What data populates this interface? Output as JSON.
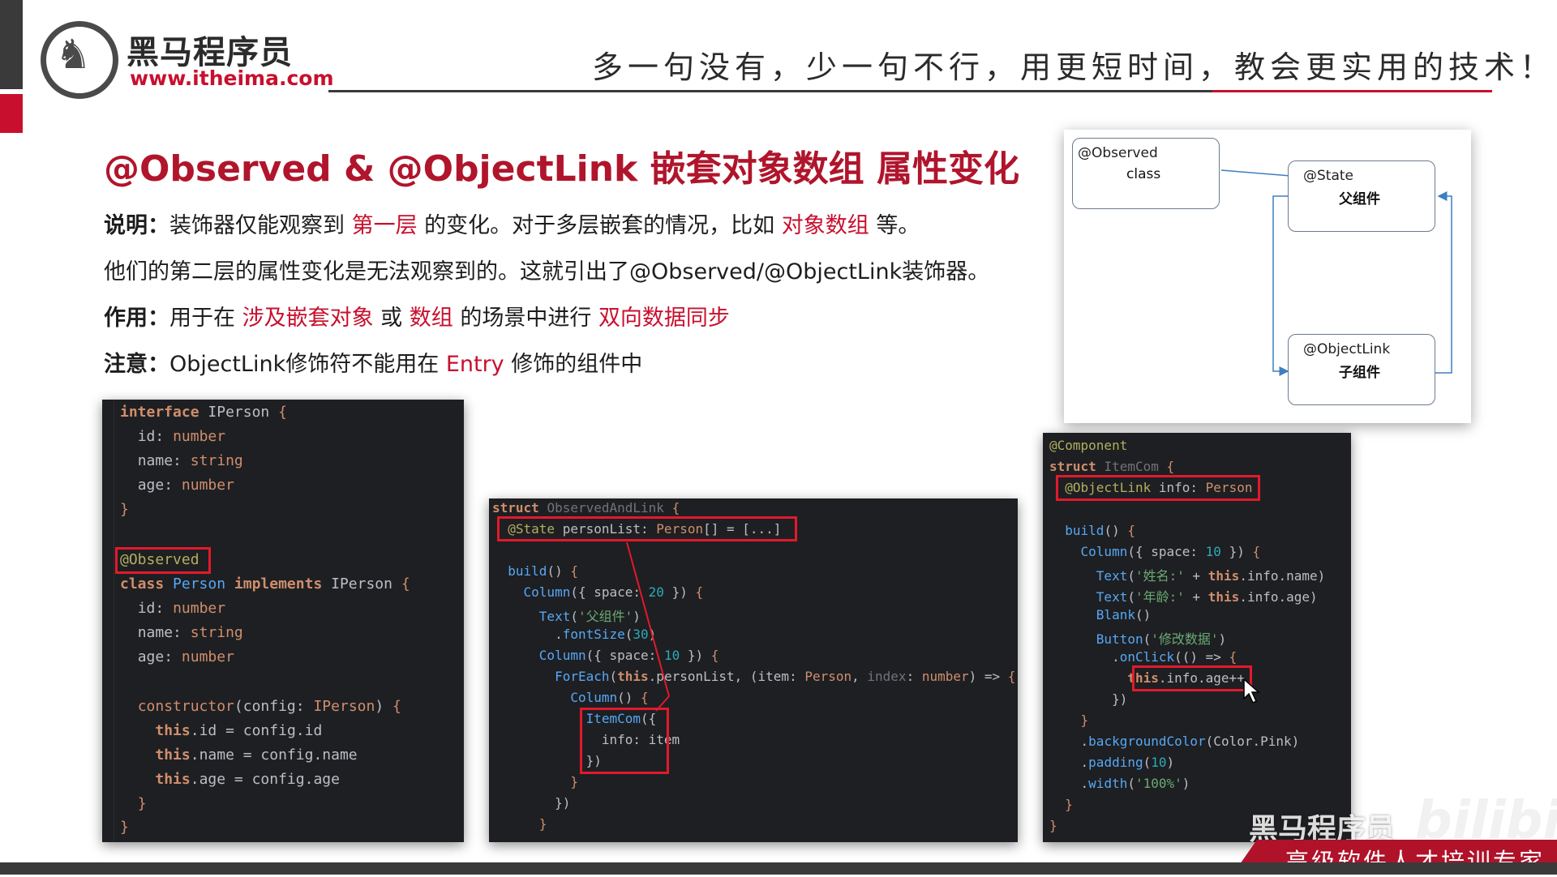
{
  "header": {
    "brand_cn": "黑马程序员",
    "brand_url": "www.itheima.com",
    "slogan": "多一句没有，少一句不行，用更短时间，教会更实用的技术！"
  },
  "slide": {
    "title": "@Observed & @ObjectLink 嵌套对象数组 属性变化",
    "desc1": {
      "label": "说明：",
      "t1": "装饰器仅能观察到 ",
      "h1": "第一层",
      "t2": " 的变化。对于多层嵌套的情况，比如 ",
      "h2": "对象数组",
      "t3": " 等。"
    },
    "desc2": "他们的第二层的属性变化是无法观察到的。这就引出了@Observed/@ObjectLink装饰器。",
    "desc3": {
      "label": "作用：",
      "t1": "用于在 ",
      "h1": "涉及嵌套对象",
      "t2": " 或 ",
      "h2": "数组",
      "t3": " 的场景中进行 ",
      "h3": "双向数据同步"
    },
    "desc4": {
      "label": "注意：",
      "t1": "ObjectLink修饰符不能用在 ",
      "h1": "Entry",
      "t2": " 修饰的组件中"
    }
  },
  "diagram": {
    "box_observed": {
      "line1": "@Observed",
      "line2": "class"
    },
    "box_state": {
      "line1": "@State",
      "line2": "父组件"
    },
    "box_objectlink": {
      "line1": "@ObjectLink",
      "line2": "子组件"
    }
  },
  "code_panel_1": {
    "lines": [
      "interface IPerson {",
      "  id: number",
      "  name: string",
      "  age: number",
      "}",
      "",
      "@Observed",
      "class Person implements IPerson {",
      "  id: number",
      "  name: string",
      "  age: number",
      "",
      "  constructor(config: IPerson) {",
      "    this.id = config.id",
      "    this.name = config.name",
      "    this.age = config.age",
      "  }",
      "}"
    ]
  },
  "code_panel_2": {
    "lines": [
      "struct ObservedAndLink {",
      "  @State personList: Person[] = [...]",
      "",
      "  build() {",
      "    Column({ space: 20 }) {",
      "      Text('父组件')",
      "        .fontSize(30)",
      "      Column({ space: 10 }) {",
      "        ForEach(this.personList, (item: Person, index: number) => {",
      "          Column() {",
      "            ItemCom({",
      "              info: item",
      "            })",
      "          }",
      "        })",
      "      }"
    ]
  },
  "code_panel_3": {
    "lines": [
      "@Component",
      "struct ItemCom {",
      "  @ObjectLink info: Person",
      "",
      "  build() {",
      "    Column({ space: 10 }) {",
      "      Text('姓名:' + this.info.name)",
      "      Text('年龄:' + this.info.age)",
      "      Blank()",
      "      Button('修改数据')",
      "        .onClick(() => {",
      "          this.info.age++",
      "        })",
      "    }",
      "    .backgroundColor(Color.Pink)",
      "    .padding(10)",
      "    .width('100%')",
      "  }",
      "}"
    ]
  },
  "watermark": {
    "brand": "黑马程序员",
    "site": "bilibili",
    "footer": "高级软件人才培训专家"
  },
  "colors": {
    "accent_red": "#c8102e",
    "code_bg": "#1e1f22",
    "box_red": "#e2192c"
  }
}
